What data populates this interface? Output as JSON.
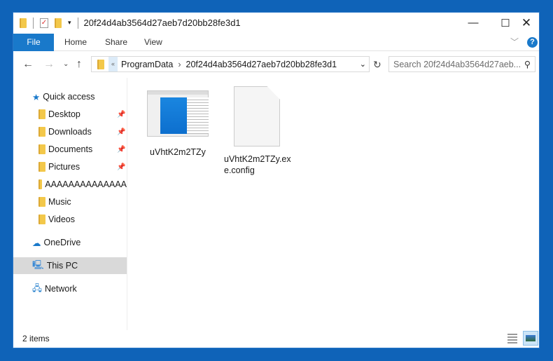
{
  "window": {
    "title": "20f24d4ab3564d27aeb7d20bb28fe3d1"
  },
  "ribbon": {
    "tabs": [
      "File",
      "Home",
      "Share",
      "View"
    ]
  },
  "address": {
    "crumbs": [
      "ProgramData",
      "20f24d4ab3564d27aeb7d20bb28fe3d1"
    ],
    "search_placeholder": "Search 20f24d4ab3564d27aeb..."
  },
  "sidebar": {
    "quick_access": "Quick access",
    "items": [
      "Desktop",
      "Downloads",
      "Documents",
      "Pictures",
      "AAAAAAAAAAAAAA",
      "Music",
      "Videos"
    ],
    "onedrive": "OneDrive",
    "thispc": "This PC",
    "network": "Network"
  },
  "files": [
    {
      "name": "uVhtK2m2TZy",
      "type": "application"
    },
    {
      "name": "uVhtK2m2TZy.exe.config",
      "name_line1": "uVhtK2m2TZy.ex",
      "name_line2": "e.config",
      "type": "config"
    }
  ],
  "status": {
    "count": "2 items"
  },
  "colors": {
    "accent": "#1979ca",
    "desktop": "#0f63b8"
  }
}
